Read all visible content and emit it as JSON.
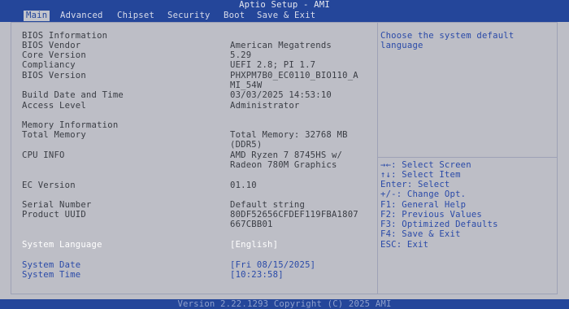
{
  "title": "Aptio Setup - AMI",
  "menu": [
    "Main",
    "Advanced",
    "Chipset",
    "Security",
    "Boot",
    "Save & Exit"
  ],
  "fields": {
    "bios_info": "BIOS Information",
    "bios_vendor_label": "BIOS Vendor",
    "bios_vendor_value": "American Megatrends",
    "core_version_label": "Core Version",
    "core_version_value": "5.29",
    "compliancy_label": "Compliancy",
    "compliancy_value": "UEFI 2.8; PI 1.7",
    "bios_version_label": "BIOS Version",
    "bios_version_value_1": "PHXPM7B0_EC0110_BIO110_A",
    "bios_version_value_2": "MI_54W",
    "build_date_label": "Build Date and Time",
    "build_date_value": "03/03/2025 14:53:10",
    "access_level_label": "Access Level",
    "access_level_value": "Administrator",
    "memory_info": "Memory Information",
    "total_memory_label": "Total Memory",
    "total_memory_value_1": "Total Memory: 32768 MB",
    "total_memory_value_2": "(DDR5)",
    "cpu_info_label": "CPU INFO",
    "cpu_info_value_1": "AMD Ryzen 7 8745HS w/",
    "cpu_info_value_2": "Radeon 780M Graphics",
    "ec_version_label": "EC Version",
    "ec_version_value": "01.10",
    "serial_label": "Serial Number",
    "serial_value": "Default string",
    "uuid_label": "Product UUID",
    "uuid_value_1": "80DF52656CFDEF119FBA1807",
    "uuid_value_2": "667CBB01",
    "language_label": "System Language",
    "language_value": "[English]",
    "date_label": "System Date",
    "date_value": "[Fri 08/15/2025]",
    "time_label": "System Time",
    "time_value": "[10:23:58]"
  },
  "help": {
    "line1": "Choose the system default",
    "line2": "language"
  },
  "keys": [
    "→←: Select Screen",
    "↑↓: Select Item",
    "Enter: Select",
    "+/-: Change Opt.",
    "F1: General Help",
    "F2: Previous Values",
    "F3: Optimized Defaults",
    "F4: Save & Exit",
    "ESC: Exit"
  ],
  "footer": "Version 2.22.1293 Copyright (C) 2025 AMI",
  "colors": {
    "background": "#bdbec6",
    "header_blue": "#24469a",
    "link_blue": "#2a4aa8",
    "text": "#3a3d44",
    "selected": "#ffffff"
  }
}
